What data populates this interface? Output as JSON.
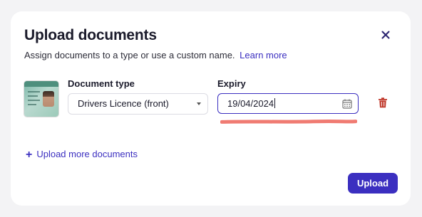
{
  "modal": {
    "title": "Upload documents",
    "subtitle": "Assign documents to a type or use a custom name.",
    "learn_more": "Learn more"
  },
  "document": {
    "type_label": "Document type",
    "type_value": "Drivers Licence (front)",
    "expiry_label": "Expiry",
    "expiry_value": "19/04/2024"
  },
  "actions": {
    "upload_more": "Upload more documents",
    "upload": "Upload"
  },
  "icons": {
    "close": "close-icon",
    "calendar": "calendar-icon",
    "delete": "trash-icon",
    "plus": "plus-icon"
  },
  "colors": {
    "accent": "#3b2fc0",
    "danger": "#c0392b",
    "annotation": "#f07b72"
  }
}
